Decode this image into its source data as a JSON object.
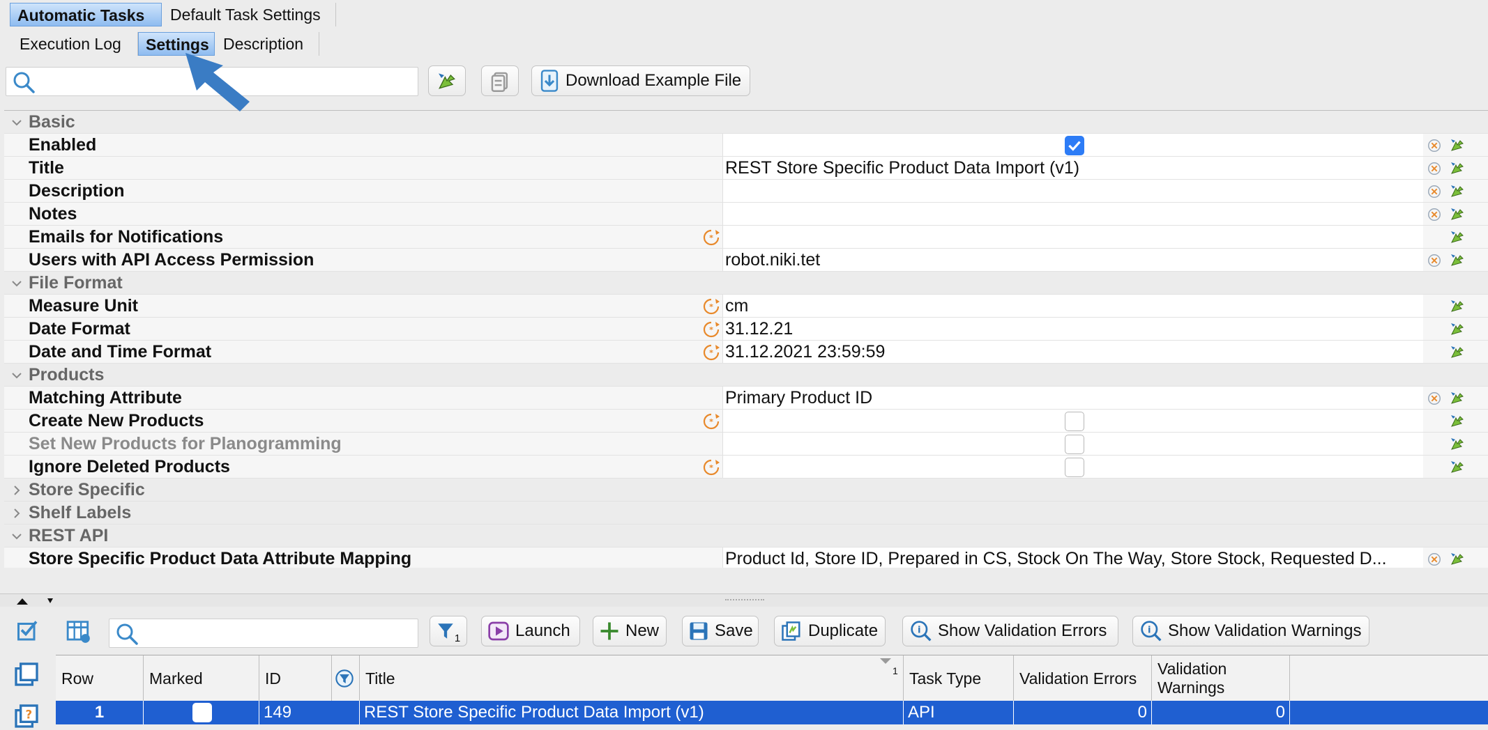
{
  "top_tabs": [
    "Automatic Tasks",
    "Default Task Settings"
  ],
  "sub_tabs": [
    "Execution Log",
    "Settings",
    "Description"
  ],
  "toolbar": {
    "download_label": "Download Example File"
  },
  "properties": [
    {
      "section": "Basic"
    },
    {
      "label": "Enabled",
      "value": "",
      "checkbox": true,
      "checked": true,
      "reset": true
    },
    {
      "label": "Title",
      "value": "REST Store Specific Product Data Import (v1)",
      "reset": true
    },
    {
      "label": "Description",
      "value": "",
      "reset": true
    },
    {
      "label": "Notes",
      "value": "",
      "reset": true
    },
    {
      "label": "Emails for Notifications",
      "value": "",
      "flag": true
    },
    {
      "label": "Users with API Access Permission",
      "value": "robot.niki.tet",
      "reset": true
    },
    {
      "section": "File Format"
    },
    {
      "label": "Measure Unit",
      "value": "cm",
      "flag": true
    },
    {
      "label": "Date Format",
      "value": "31.12.21",
      "flag": true
    },
    {
      "label": "Date and Time Format",
      "value": "31.12.2021 23:59:59",
      "flag": true
    },
    {
      "section": "Products"
    },
    {
      "label": "Matching Attribute",
      "value": "Primary Product ID",
      "reset": true
    },
    {
      "label": "Create New Products",
      "value": "",
      "checkbox": true,
      "checked": false,
      "flag": true
    },
    {
      "label": "Set New Products for Planogramming",
      "value": "",
      "checkbox": true,
      "checked": false,
      "disabled": true
    },
    {
      "label": "Ignore Deleted Products",
      "value": "",
      "checkbox": true,
      "checked": false,
      "flag": true
    },
    {
      "section": "Store Specific",
      "collapsed": true
    },
    {
      "section": "Shelf Labels",
      "collapsed": true
    },
    {
      "section": "REST API"
    },
    {
      "label": "Store Specific Product Data Attribute Mapping",
      "value": "Product Id, Store ID, Prepared in CS, Stock On The Way, Store Stock, Requested D...",
      "reset": true
    }
  ],
  "bottom_toolbar": {
    "filter_badge": "1",
    "launch_label": "Launch",
    "new_label": "New",
    "save_label": "Save",
    "duplicate_label": "Duplicate",
    "show_errors_label": "Show Validation Errors",
    "show_warnings_label": "Show Validation Warnings"
  },
  "table": {
    "headers": [
      "Row",
      "Marked",
      "ID",
      "",
      "Title",
      "Task Type",
      "Validation Errors",
      "Validation Warnings"
    ],
    "sort_index": "1",
    "rows": [
      {
        "row": "1",
        "marked": false,
        "id": "149",
        "title": "REST Store Specific Product Data Import (v1)",
        "task_type": "API",
        "errors": "0",
        "warnings": "0"
      }
    ]
  },
  "colors": {
    "accent": "#1f5fd1",
    "flag_orange": "#e8892b",
    "check_blue": "#2d7cf6",
    "arrow_blue": "#3a7cc4"
  }
}
